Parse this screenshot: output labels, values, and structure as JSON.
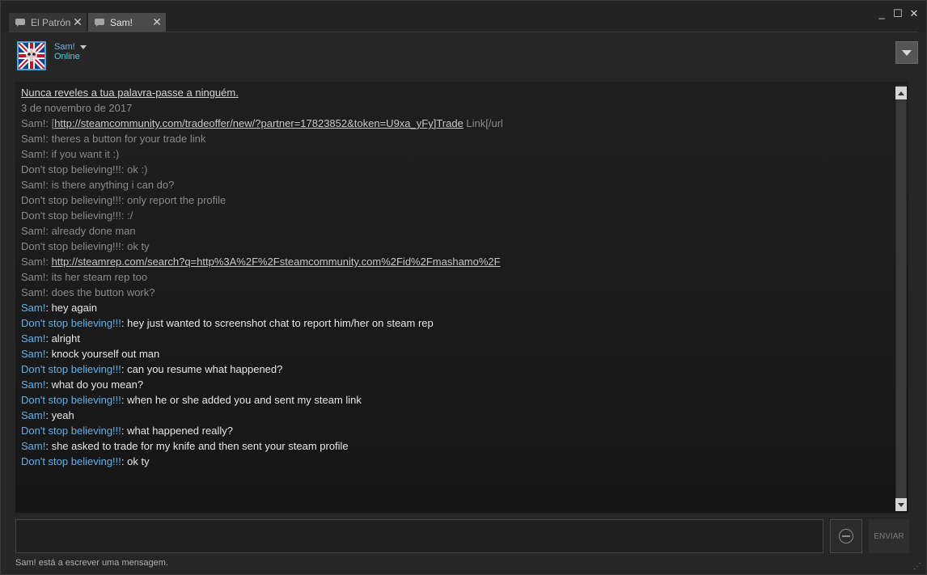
{
  "tabs": [
    {
      "label": "El Patrón",
      "close": "✕"
    },
    {
      "label": "Sam!",
      "close": "✕"
    }
  ],
  "window_controls": {
    "minimize": "_",
    "maximize": "☐",
    "close": "✕"
  },
  "header": {
    "friend_name": "Sam!",
    "status": "Online"
  },
  "chat": {
    "warning": "Nunca reveles a tua palavra-passe a ninguém.",
    "date": "3 de novembro de 2017",
    "old_messages": [
      {
        "sender": "Sam!",
        "pre": "[",
        "link": "http://steamcommunity.com/tradeoffer/new/?partner=17823852&token=U9xa_yFy]Trade",
        "post": " Link[/url"
      },
      {
        "sender": "Sam!",
        "text": "theres a button for your trade link"
      },
      {
        "sender": "Sam!",
        "text": "if you want it :)"
      },
      {
        "sender": "Don't stop believing!!!",
        "text": "ok :)"
      },
      {
        "sender": "Sam!",
        "text": "is there anything i can do?"
      },
      {
        "sender": "Don't stop believing!!!",
        "text": "only report the profile"
      },
      {
        "sender": "Don't stop believing!!!",
        "text": ":/"
      },
      {
        "sender": "Sam!",
        "text": "already done man"
      },
      {
        "sender": "Don't stop believing!!!",
        "text": "ok ty"
      },
      {
        "sender": "Sam!",
        "pre": "",
        "link": "http://steamrep.com/search?q=http%3A%2F%2Fsteamcommunity.com%2Fid%2Fmashamo%2F",
        "post": ""
      },
      {
        "sender": "Sam!",
        "text": "its her steam rep too"
      },
      {
        "sender": "Sam!",
        "text": "does the button work?"
      }
    ],
    "new_messages": [
      {
        "sender": "Sam!",
        "text": "hey again"
      },
      {
        "sender": "Don't stop believing!!!",
        "text": "hey just wanted to screenshot chat to report him/her on steam rep"
      },
      {
        "sender": "Sam!",
        "text": "alright"
      },
      {
        "sender": "Sam!",
        "text": "knock yourself out man"
      },
      {
        "sender": "Don't stop believing!!!",
        "text": "can you resume what happened?"
      },
      {
        "sender": "Sam!",
        "text": "what do you mean?"
      },
      {
        "sender": "Don't stop believing!!!",
        "text": "when he or she added you and sent my steam link"
      },
      {
        "sender": "Sam!",
        "text": "yeah"
      },
      {
        "sender": "Don't stop believing!!!",
        "text": "what happened really?"
      },
      {
        "sender": "Sam!",
        "text": "she asked to trade for my knife and then sent your steam profile"
      },
      {
        "sender": "Don't stop believing!!!",
        "text": "ok ty"
      }
    ]
  },
  "input": {
    "send_label": "ENVIAR",
    "typing_status": "Sam! está a escrever uma mensagem."
  },
  "icons": {
    "tab": "chat-bubble-icon",
    "avatar": "union-jack-skull-avatar",
    "emoji": "emoji-face-icon",
    "grip": "resize-grip-icon"
  },
  "colors": {
    "accent": "#62b0e7",
    "status": "#57cbde",
    "background": "#262626"
  }
}
